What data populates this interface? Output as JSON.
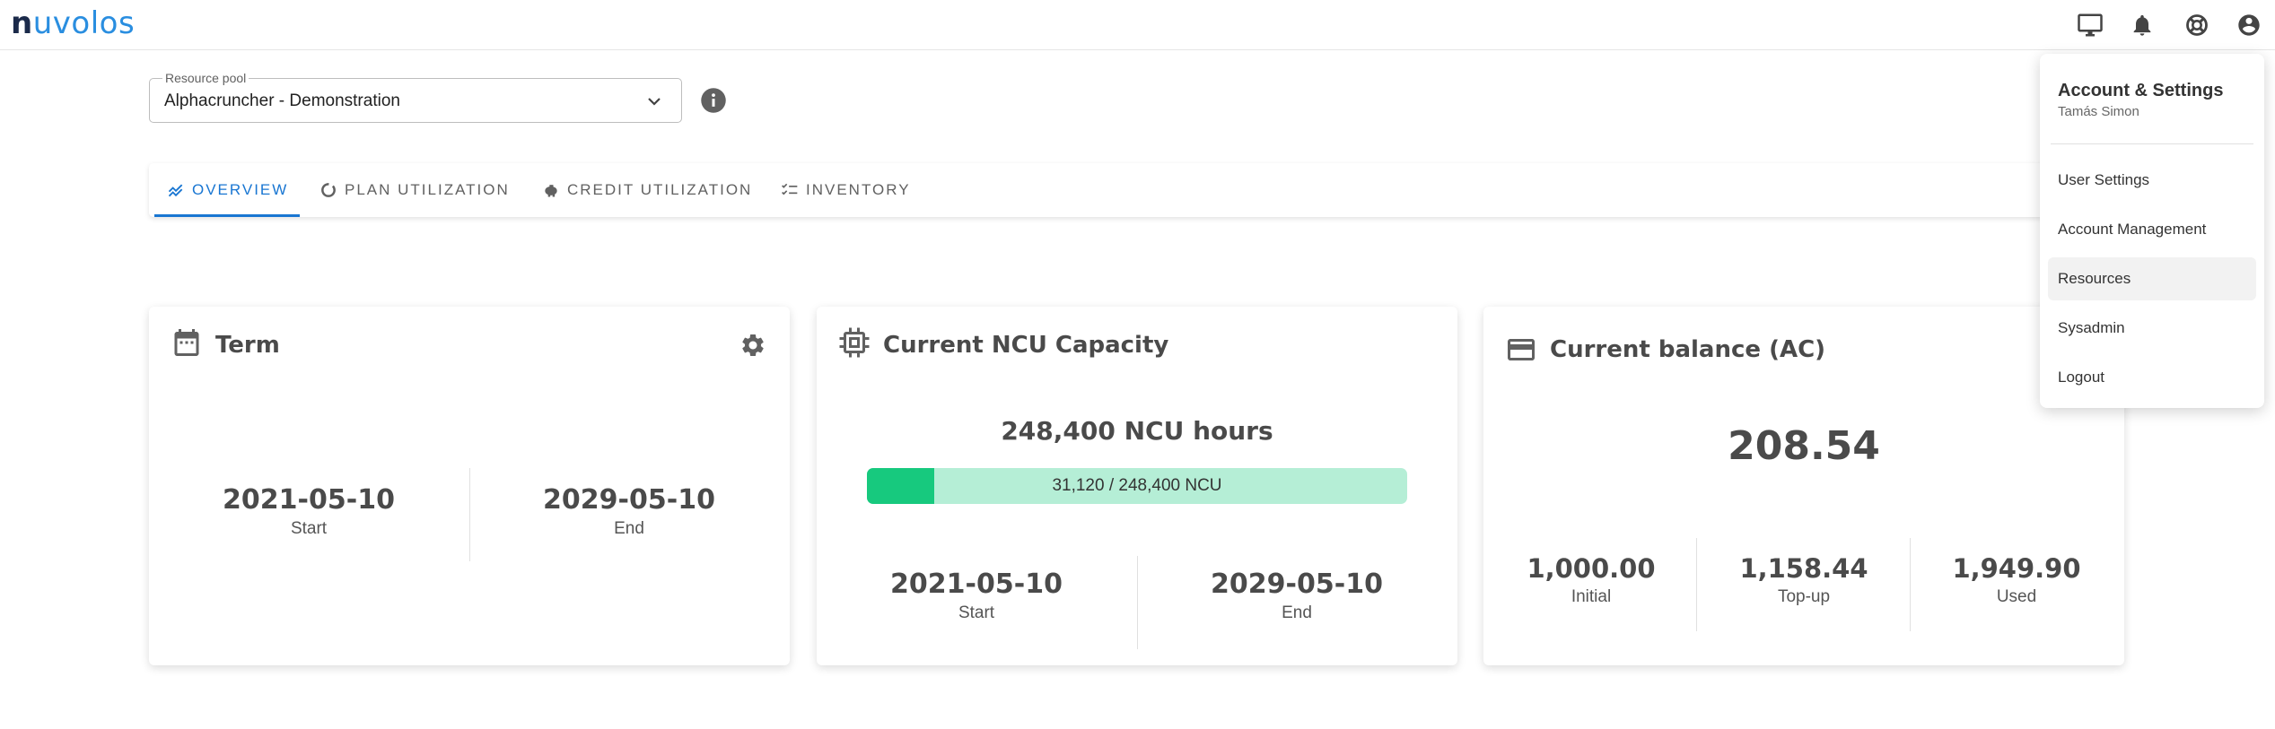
{
  "app": {
    "logo_n": "n",
    "logo_rest": "uvolos"
  },
  "topbar": {
    "icons": [
      "desktop-icon",
      "bell-icon",
      "lifebuoy-icon",
      "account-circle-icon"
    ]
  },
  "resource_pool": {
    "label": "Resource pool",
    "value": "Alphacruncher - Demonstration"
  },
  "tabs": [
    {
      "label": "OVERVIEW",
      "icon": "chart-line-icon",
      "active": true
    },
    {
      "label": "PLAN UTILIZATION",
      "icon": "donut-icon",
      "active": false
    },
    {
      "label": "CREDIT UTILIZATION",
      "icon": "piggy-bank-icon",
      "active": false
    },
    {
      "label": "INVENTORY",
      "icon": "checklist-icon",
      "active": false
    }
  ],
  "term_card": {
    "title": "Term",
    "start_value": "2021-05-10",
    "start_label": "Start",
    "end_value": "2029-05-10",
    "end_label": "End"
  },
  "ncu_card": {
    "title": "Current NCU Capacity",
    "headline": "248,400 NCU hours",
    "progress_text": "31,120 / 248,400 NCU",
    "progress_fraction": 0.1253,
    "start_value": "2021-05-10",
    "start_label": "Start",
    "end_value": "2029-05-10",
    "end_label": "End"
  },
  "balance_card": {
    "title": "Current balance (AC)",
    "balance": "208.54",
    "initial_value": "1,000.00",
    "initial_label": "Initial",
    "topup_value": "1,158.44",
    "topup_label": "Top-up",
    "used_value": "1,949.90",
    "used_label": "Used"
  },
  "account_menu": {
    "title": "Account & Settings",
    "user": "Tamás Simon",
    "items": [
      "User Settings",
      "Account Management",
      "Resources",
      "Sysadmin",
      "Logout"
    ],
    "highlighted": "Resources"
  },
  "colors": {
    "primary": "#1976d2",
    "progress_fill": "#17c97e",
    "progress_track": "#b5eed6"
  }
}
